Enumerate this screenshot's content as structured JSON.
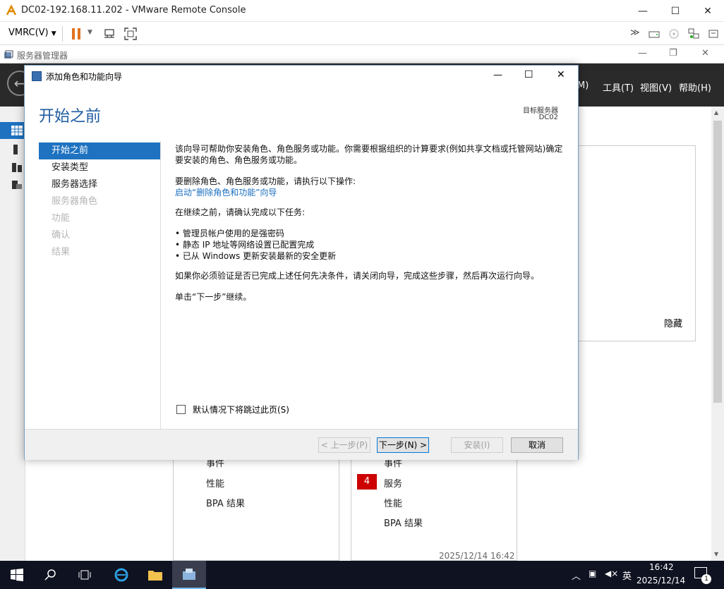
{
  "vmrc": {
    "title": "DC02-192.168.11.202 - VMware Remote Console",
    "menu_label": "VMRC(V)",
    "minimize": "—",
    "maximize": "☐",
    "close": "✕"
  },
  "server_manager": {
    "title": "服务器管理器",
    "menu": {
      "manage_partial": "M)",
      "tools": "工具(T)",
      "view": "视图(V)",
      "help": "帮助(H)"
    },
    "hide_link": "隐藏",
    "tile_left_items": [
      "事件",
      "性能",
      "BPA 结果"
    ],
    "tile_right_items": [
      "事件",
      "服务",
      "性能",
      "BPA 结果"
    ],
    "services_badge": "4",
    "timestamp": "2025/12/14 16:42"
  },
  "dialog": {
    "title": "添加角色和功能向导",
    "heading": "开始之前",
    "target_label": "目标服务器",
    "target_value": "DC02",
    "steps": [
      {
        "label": "开始之前",
        "state": "active"
      },
      {
        "label": "安装类型",
        "state": "enabled"
      },
      {
        "label": "服务器选择",
        "state": "enabled"
      },
      {
        "label": "服务器角色",
        "state": "disabled"
      },
      {
        "label": "功能",
        "state": "disabled"
      },
      {
        "label": "确认",
        "state": "disabled"
      },
      {
        "label": "结果",
        "state": "disabled"
      }
    ],
    "content": {
      "intro": "该向导可帮助你安装角色、角色服务或功能。你需要根据组织的计算要求(例如共享文档或托管网站)确定要安装的角色、角色服务或功能。",
      "remove_prompt": "要删除角色、角色服务或功能，请执行以下操作:",
      "remove_link": "启动“删除角色和功能”向导",
      "confirm_prompt": "在继续之前，请确认完成以下任务:",
      "tasks": [
        "管理员帐户使用的是强密码",
        "静态 IP 地址等网络设置已配置完成",
        "已从 Windows 更新安装最新的安全更新"
      ],
      "verify_note": "如果你必须验证是否已完成上述任何先决条件，请关闭向导，完成这些步骤，然后再次运行向导。",
      "next_note": "单击“下一步”继续。"
    },
    "skip_checkbox_label": "默认情况下将跳过此页(S)",
    "buttons": {
      "prev": "< 上一步(P)",
      "next": "下一步(N) >",
      "install": "安装(I)",
      "cancel": "取消"
    }
  },
  "taskbar": {
    "time": "16:42",
    "date": "2025/12/14",
    "ime": "英",
    "notification_count": "1"
  },
  "colors": {
    "accent": "#1e72c0",
    "heading": "#1e5aa0",
    "sm_header": "#2a2a2a",
    "badge": "#cc0000",
    "pause": "#e0711f"
  }
}
